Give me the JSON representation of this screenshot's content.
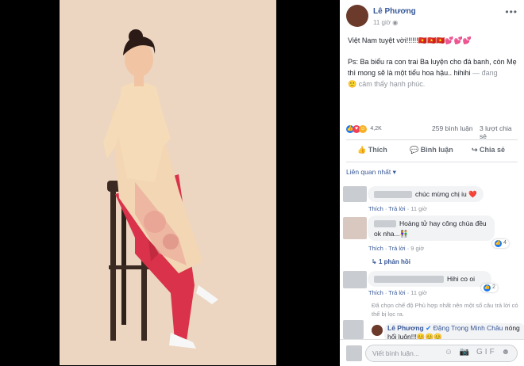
{
  "post": {
    "author": "Lê Phương",
    "time": "11 giờ",
    "privacy_icon": "globe-icon",
    "line1": "Việt Nam tuyệt vời!!!!!!",
    "line1_emoji": "🇻🇳🇻🇳🇻🇳💕💕💕",
    "line2": "Ps: Ba biểu ra con trai Ba luyện cho đá banh, còn Mẹ thì mong sẽ là một tiểu hoa hậu.. hihihi",
    "feeling": "— đang",
    "feeling2": "cảm thấy hạnh phúc.",
    "more": "•••"
  },
  "stats": {
    "reactions": "4,2K",
    "comments": "259 bình luận",
    "shares": "3 lượt chia sẻ"
  },
  "actions": {
    "like": "Thích",
    "comment": "Bình luận",
    "share": "Chia sẻ"
  },
  "sort": "Liên quan nhất ▾",
  "comments": [
    {
      "text": "chúc mừng chị iu ❤️",
      "like": "Thích",
      "reply": "Trả lời",
      "time": "11 giờ"
    },
    {
      "text": "Hoàng tử hay công chúa đều ok nha...👫",
      "like": "Thích",
      "reply": "Trả lời",
      "time": "9 giờ",
      "likes": "4"
    },
    {
      "replies": "1 phản hồi"
    },
    {
      "text": "Hihi co oi",
      "like": "Thích",
      "reply": "Trả lời",
      "time": "11 giờ",
      "likes": "2"
    },
    {
      "notice": "Đã chọn chế độ Phù hợp nhất nên một số câu trả lời có thể bị lọc ra."
    },
    {
      "author": "Lê Phương",
      "tag": "Đặng Trọng Minh Châu",
      "text": "nóng hổi luôn!!!😊😊😊"
    }
  ],
  "composer": {
    "placeholder": "Viết bình luận...",
    "icons": "☺ 📷 GIF ☻"
  },
  "colors": {
    "link": "#365899",
    "meta": "#90949c",
    "like_blue": "#1877f2",
    "heart_red": "#f33e58"
  }
}
